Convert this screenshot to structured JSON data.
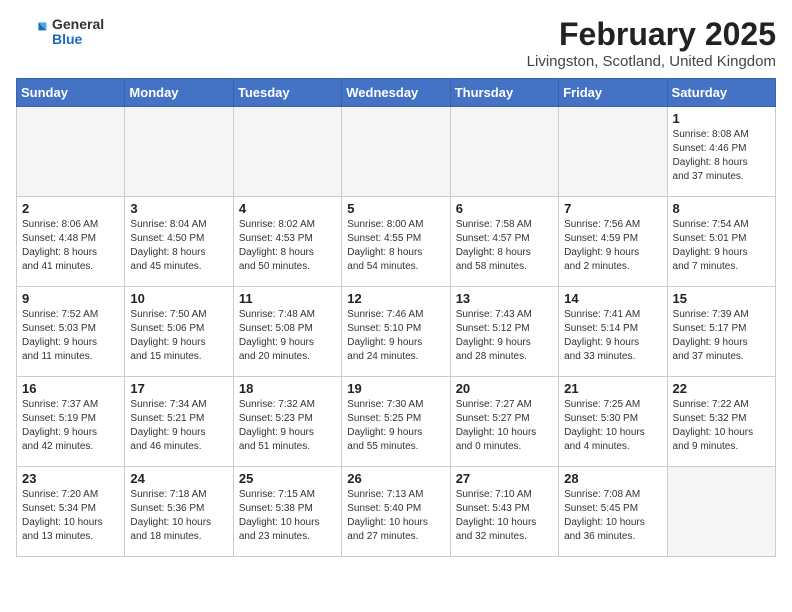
{
  "header": {
    "logo_general": "General",
    "logo_blue": "Blue",
    "month": "February 2025",
    "location": "Livingston, Scotland, United Kingdom"
  },
  "weekdays": [
    "Sunday",
    "Monday",
    "Tuesday",
    "Wednesday",
    "Thursday",
    "Friday",
    "Saturday"
  ],
  "weeks": [
    [
      {
        "day": "",
        "info": ""
      },
      {
        "day": "",
        "info": ""
      },
      {
        "day": "",
        "info": ""
      },
      {
        "day": "",
        "info": ""
      },
      {
        "day": "",
        "info": ""
      },
      {
        "day": "",
        "info": ""
      },
      {
        "day": "1",
        "info": "Sunrise: 8:08 AM\nSunset: 4:46 PM\nDaylight: 8 hours\nand 37 minutes."
      }
    ],
    [
      {
        "day": "2",
        "info": "Sunrise: 8:06 AM\nSunset: 4:48 PM\nDaylight: 8 hours\nand 41 minutes."
      },
      {
        "day": "3",
        "info": "Sunrise: 8:04 AM\nSunset: 4:50 PM\nDaylight: 8 hours\nand 45 minutes."
      },
      {
        "day": "4",
        "info": "Sunrise: 8:02 AM\nSunset: 4:53 PM\nDaylight: 8 hours\nand 50 minutes."
      },
      {
        "day": "5",
        "info": "Sunrise: 8:00 AM\nSunset: 4:55 PM\nDaylight: 8 hours\nand 54 minutes."
      },
      {
        "day": "6",
        "info": "Sunrise: 7:58 AM\nSunset: 4:57 PM\nDaylight: 8 hours\nand 58 minutes."
      },
      {
        "day": "7",
        "info": "Sunrise: 7:56 AM\nSunset: 4:59 PM\nDaylight: 9 hours\nand 2 minutes."
      },
      {
        "day": "8",
        "info": "Sunrise: 7:54 AM\nSunset: 5:01 PM\nDaylight: 9 hours\nand 7 minutes."
      }
    ],
    [
      {
        "day": "9",
        "info": "Sunrise: 7:52 AM\nSunset: 5:03 PM\nDaylight: 9 hours\nand 11 minutes."
      },
      {
        "day": "10",
        "info": "Sunrise: 7:50 AM\nSunset: 5:06 PM\nDaylight: 9 hours\nand 15 minutes."
      },
      {
        "day": "11",
        "info": "Sunrise: 7:48 AM\nSunset: 5:08 PM\nDaylight: 9 hours\nand 20 minutes."
      },
      {
        "day": "12",
        "info": "Sunrise: 7:46 AM\nSunset: 5:10 PM\nDaylight: 9 hours\nand 24 minutes."
      },
      {
        "day": "13",
        "info": "Sunrise: 7:43 AM\nSunset: 5:12 PM\nDaylight: 9 hours\nand 28 minutes."
      },
      {
        "day": "14",
        "info": "Sunrise: 7:41 AM\nSunset: 5:14 PM\nDaylight: 9 hours\nand 33 minutes."
      },
      {
        "day": "15",
        "info": "Sunrise: 7:39 AM\nSunset: 5:17 PM\nDaylight: 9 hours\nand 37 minutes."
      }
    ],
    [
      {
        "day": "16",
        "info": "Sunrise: 7:37 AM\nSunset: 5:19 PM\nDaylight: 9 hours\nand 42 minutes."
      },
      {
        "day": "17",
        "info": "Sunrise: 7:34 AM\nSunset: 5:21 PM\nDaylight: 9 hours\nand 46 minutes."
      },
      {
        "day": "18",
        "info": "Sunrise: 7:32 AM\nSunset: 5:23 PM\nDaylight: 9 hours\nand 51 minutes."
      },
      {
        "day": "19",
        "info": "Sunrise: 7:30 AM\nSunset: 5:25 PM\nDaylight: 9 hours\nand 55 minutes."
      },
      {
        "day": "20",
        "info": "Sunrise: 7:27 AM\nSunset: 5:27 PM\nDaylight: 10 hours\nand 0 minutes."
      },
      {
        "day": "21",
        "info": "Sunrise: 7:25 AM\nSunset: 5:30 PM\nDaylight: 10 hours\nand 4 minutes."
      },
      {
        "day": "22",
        "info": "Sunrise: 7:22 AM\nSunset: 5:32 PM\nDaylight: 10 hours\nand 9 minutes."
      }
    ],
    [
      {
        "day": "23",
        "info": "Sunrise: 7:20 AM\nSunset: 5:34 PM\nDaylight: 10 hours\nand 13 minutes."
      },
      {
        "day": "24",
        "info": "Sunrise: 7:18 AM\nSunset: 5:36 PM\nDaylight: 10 hours\nand 18 minutes."
      },
      {
        "day": "25",
        "info": "Sunrise: 7:15 AM\nSunset: 5:38 PM\nDaylight: 10 hours\nand 23 minutes."
      },
      {
        "day": "26",
        "info": "Sunrise: 7:13 AM\nSunset: 5:40 PM\nDaylight: 10 hours\nand 27 minutes."
      },
      {
        "day": "27",
        "info": "Sunrise: 7:10 AM\nSunset: 5:43 PM\nDaylight: 10 hours\nand 32 minutes."
      },
      {
        "day": "28",
        "info": "Sunrise: 7:08 AM\nSunset: 5:45 PM\nDaylight: 10 hours\nand 36 minutes."
      },
      {
        "day": "",
        "info": ""
      }
    ]
  ]
}
